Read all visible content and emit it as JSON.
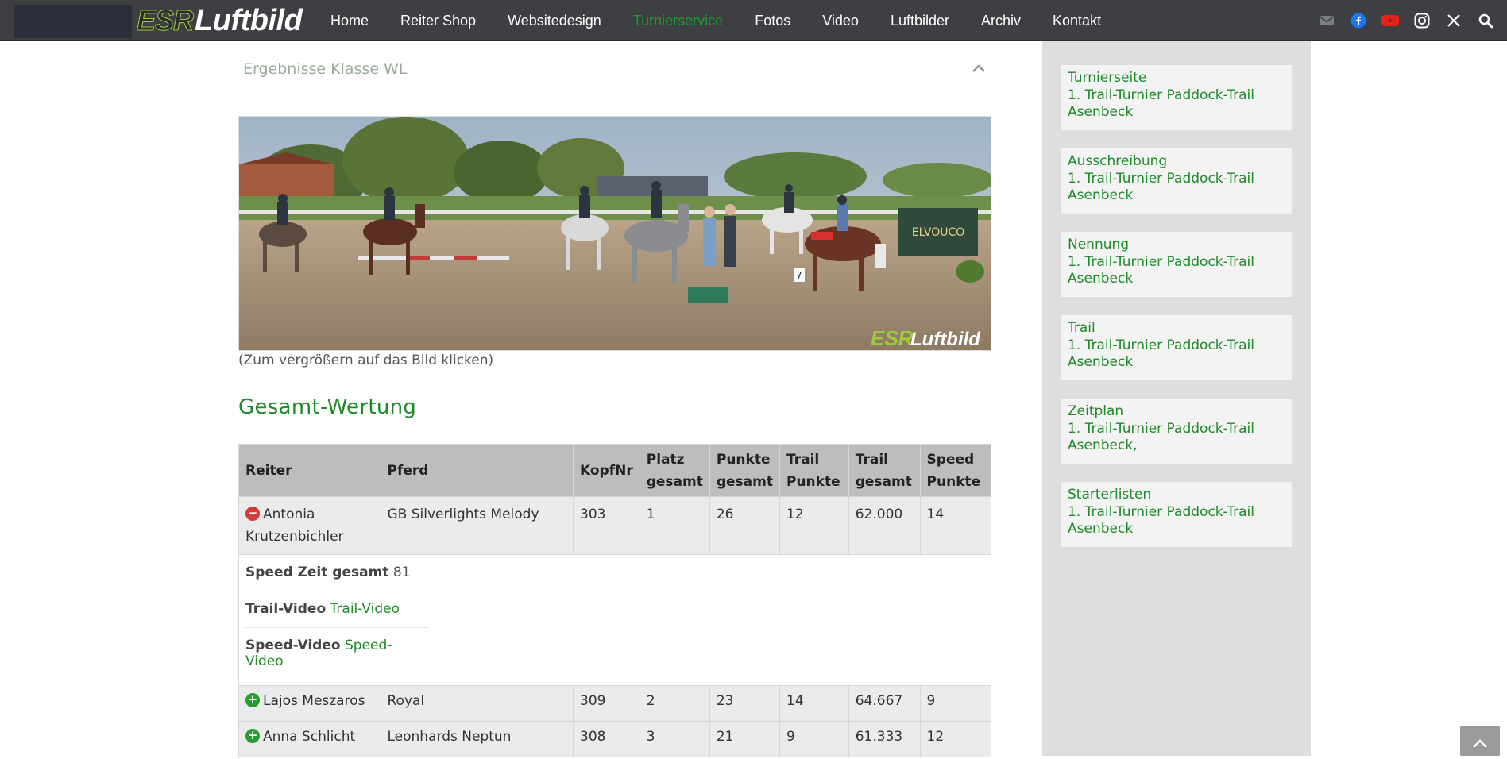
{
  "header": {
    "brand_left": "ESR",
    "brand_right": "Luftbild",
    "nav": [
      {
        "label": "Home",
        "active": false
      },
      {
        "label": "Reiter Shop",
        "active": false
      },
      {
        "label": "Websitedesign",
        "active": false
      },
      {
        "label": "Turnierservice",
        "active": true
      },
      {
        "label": "Fotos",
        "active": false
      },
      {
        "label": "Video",
        "active": false
      },
      {
        "label": "Luftbilder",
        "active": false
      },
      {
        "label": "Archiv",
        "active": false
      },
      {
        "label": "Kontakt",
        "active": false
      }
    ],
    "social": [
      "mail-icon",
      "facebook-icon",
      "youtube-icon",
      "instagram-icon",
      "x-icon",
      "search-icon"
    ],
    "colors": {
      "bar": "#3d3f42",
      "active": "#1e9a2e",
      "facebook": "#1877f2",
      "youtube": "#e62117"
    }
  },
  "accordion": {
    "title": "Ergebnisse Klasse WL"
  },
  "photo": {
    "watermark_left": "ESR",
    "watermark_right": "Luftbild",
    "sign_number": "7",
    "banner_text": "ELVOUCO"
  },
  "caption": "(Zum vergrößern auf das Bild klicken)",
  "section_title": "Gesamt-Wertung",
  "table": {
    "headers": [
      "Reiter",
      "Pferd",
      "KopfNr",
      "Platz gesamt",
      "Punkte gesamt",
      "Trail Punkte",
      "Trail gesamt",
      "Speed Punkte"
    ],
    "rows": [
      {
        "reiter": "Antonia Krutzenbichler",
        "pferd": "GB Silverlights Melody",
        "kopfnr": "303",
        "platz": "1",
        "punkte": "26",
        "trail_punkte": "12",
        "trail_gesamt": "62.000",
        "speed_punkte": "14",
        "expanded": true
      },
      {
        "reiter": "Lajos Meszaros",
        "pferd": "Royal",
        "kopfnr": "309",
        "platz": "2",
        "punkte": "23",
        "trail_punkte": "14",
        "trail_gesamt": "64.667",
        "speed_punkte": "9",
        "expanded": false
      },
      {
        "reiter": "Anna Schlicht",
        "pferd": "Leonhards Neptun",
        "kopfnr": "308",
        "platz": "3",
        "punkte": "21",
        "trail_punkte": "9",
        "trail_gesamt": "61.333",
        "speed_punkte": "12",
        "expanded": false
      }
    ],
    "detail": {
      "speed_zeit_label": "Speed Zeit gesamt",
      "speed_zeit_value": "81",
      "trail_video_label": "Trail-Video",
      "trail_video_link": "Trail-Video",
      "speed_video_label": "Speed-Video",
      "speed_video_link": "Speed-Video"
    }
  },
  "sidebar": {
    "boxes": [
      [
        "Turnierseite",
        "1. Trail-Turnier Paddock-Trail",
        "Asenbeck"
      ],
      [
        "Ausschreibung",
        "1. Trail-Turnier Paddock-Trail",
        "Asenbeck"
      ],
      [
        "Nennung",
        "1. Trail-Turnier Paddock-Trail",
        "Asenbeck"
      ],
      [
        "Trail",
        "1. Trail-Turnier Paddock-Trail",
        "Asenbeck"
      ],
      [
        "Zeitplan",
        "1. Trail-Turnier Paddock-Trail",
        "Asenbeck,"
      ],
      [
        "Starterlisten",
        "1. Trail-Turnier Paddock-Trail",
        "Asenbeck"
      ]
    ]
  }
}
